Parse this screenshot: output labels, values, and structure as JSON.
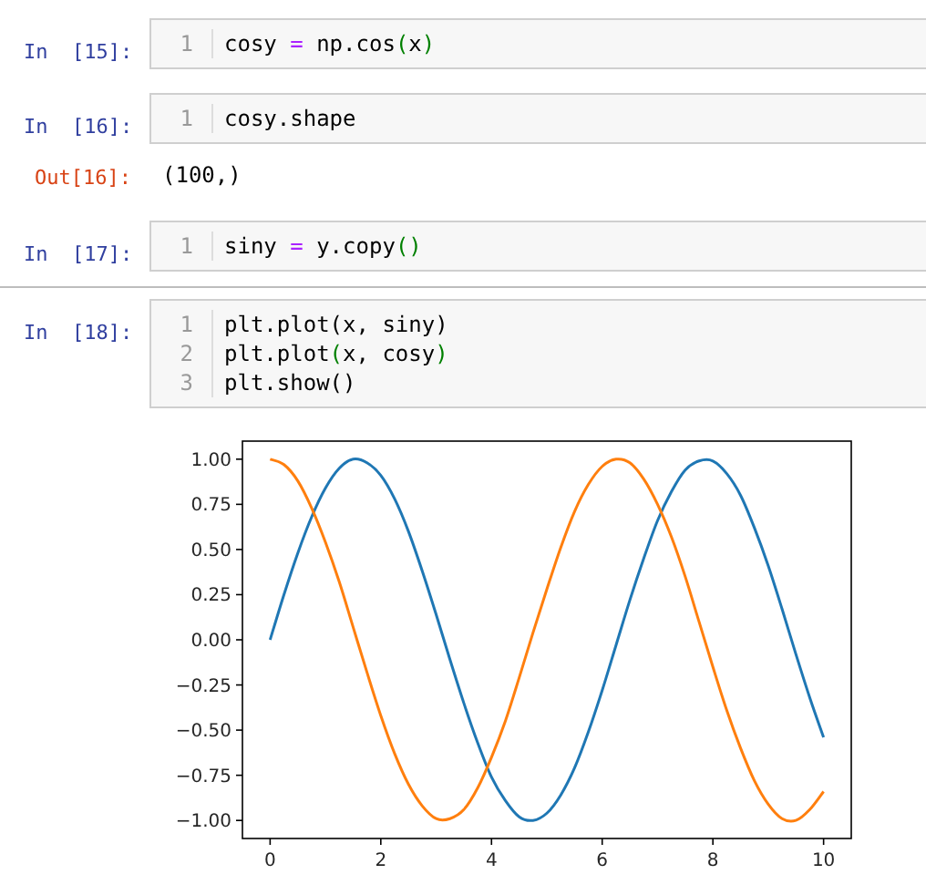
{
  "cells": [
    {
      "kind": "input",
      "prompt": "In  [15]:",
      "lines": [
        {
          "number": "1",
          "tokens": [
            {
              "kind": "name",
              "text": "cosy "
            },
            {
              "kind": "operator",
              "text": "="
            },
            {
              "kind": "name",
              "text": " np.cos"
            },
            {
              "kind": "paren",
              "text": "("
            },
            {
              "kind": "name",
              "text": "x"
            },
            {
              "kind": "paren",
              "text": ")"
            }
          ]
        }
      ]
    },
    {
      "kind": "input",
      "prompt": "In  [16]:",
      "lines": [
        {
          "number": "1",
          "tokens": [
            {
              "kind": "name",
              "text": "cosy.shape"
            }
          ]
        }
      ]
    },
    {
      "kind": "output",
      "prompt": "Out[16]:",
      "text": "(100,)"
    },
    {
      "kind": "input",
      "prompt": "In  [17]:",
      "lines": [
        {
          "number": "1",
          "tokens": [
            {
              "kind": "name",
              "text": "siny "
            },
            {
              "kind": "operator",
              "text": "="
            },
            {
              "kind": "name",
              "text": " y.copy"
            },
            {
              "kind": "paren",
              "text": "()"
            }
          ]
        }
      ]
    },
    {
      "kind": "divider"
    },
    {
      "kind": "input",
      "prompt": "In  [18]:",
      "lines": [
        {
          "number": "1",
          "tokens": [
            {
              "kind": "name",
              "text": "plt.plot(x, siny)"
            }
          ]
        },
        {
          "number": "2",
          "tokens": [
            {
              "kind": "name",
              "text": "plt.plot"
            },
            {
              "kind": "paren",
              "text": "("
            },
            {
              "kind": "name",
              "text": "x, cosy"
            },
            {
              "kind": "paren",
              "text": ")"
            }
          ]
        },
        {
          "number": "3",
          "tokens": [
            {
              "kind": "name",
              "text": "plt.show()"
            }
          ]
        }
      ]
    },
    {
      "kind": "chart",
      "chart_data": {
        "type": "line",
        "x": [
          0,
          0.25,
          0.5,
          0.75,
          1,
          1.25,
          1.5,
          1.75,
          2,
          2.25,
          2.5,
          2.75,
          3,
          3.25,
          3.5,
          3.75,
          4,
          4.25,
          4.5,
          4.75,
          5,
          5.25,
          5.5,
          5.75,
          6,
          6.25,
          6.5,
          6.75,
          7,
          7.25,
          7.5,
          7.75,
          8,
          8.25,
          8.5,
          8.75,
          9,
          9.25,
          9.5,
          9.75,
          10
        ],
        "series": [
          {
            "color": "#1f77b4",
            "values": [
              0.0,
              0.25,
              0.48,
              0.68,
              0.84,
              0.95,
              1.0,
              0.98,
              0.91,
              0.78,
              0.6,
              0.38,
              0.14,
              -0.11,
              -0.35,
              -0.57,
              -0.76,
              -0.89,
              -0.98,
              -1.0,
              -0.96,
              -0.86,
              -0.71,
              -0.51,
              -0.28,
              -0.03,
              0.22,
              0.45,
              0.66,
              0.82,
              0.94,
              0.99,
              0.99,
              0.92,
              0.8,
              0.62,
              0.41,
              0.17,
              -0.08,
              -0.32,
              -0.54
            ]
          },
          {
            "color": "#ff7f0e",
            "values": [
              1.0,
              0.97,
              0.88,
              0.73,
              0.54,
              0.32,
              0.07,
              -0.18,
              -0.42,
              -0.63,
              -0.8,
              -0.92,
              -0.99,
              -0.99,
              -0.94,
              -0.82,
              -0.65,
              -0.45,
              -0.21,
              0.04,
              0.28,
              0.51,
              0.71,
              0.86,
              0.96,
              1.0,
              0.98,
              0.89,
              0.75,
              0.57,
              0.35,
              0.1,
              -0.15,
              -0.39,
              -0.6,
              -0.78,
              -0.91,
              -0.99,
              -1.0,
              -0.94,
              -0.84
            ]
          }
        ],
        "xlim": [
          -0.5,
          10.5
        ],
        "ylim": [
          -1.1,
          1.1
        ],
        "xticks": [
          {
            "value": 0,
            "label": "0"
          },
          {
            "value": 2,
            "label": "2"
          },
          {
            "value": 4,
            "label": "4"
          },
          {
            "value": 6,
            "label": "6"
          },
          {
            "value": 8,
            "label": "8"
          },
          {
            "value": 10,
            "label": "10"
          }
        ],
        "yticks": [
          {
            "value": 1,
            "label": "1.00"
          },
          {
            "value": 0.75,
            "label": "0.75"
          },
          {
            "value": 0.5,
            "label": "0.50"
          },
          {
            "value": 0.25,
            "label": "0.25"
          },
          {
            "value": 0,
            "label": "0.00"
          },
          {
            "value": -0.25,
            "label": "−0.25"
          },
          {
            "value": -0.5,
            "label": "−0.50"
          },
          {
            "value": -0.75,
            "label": "−0.75"
          },
          {
            "value": -1,
            "label": "−1.00"
          }
        ]
      }
    }
  ]
}
